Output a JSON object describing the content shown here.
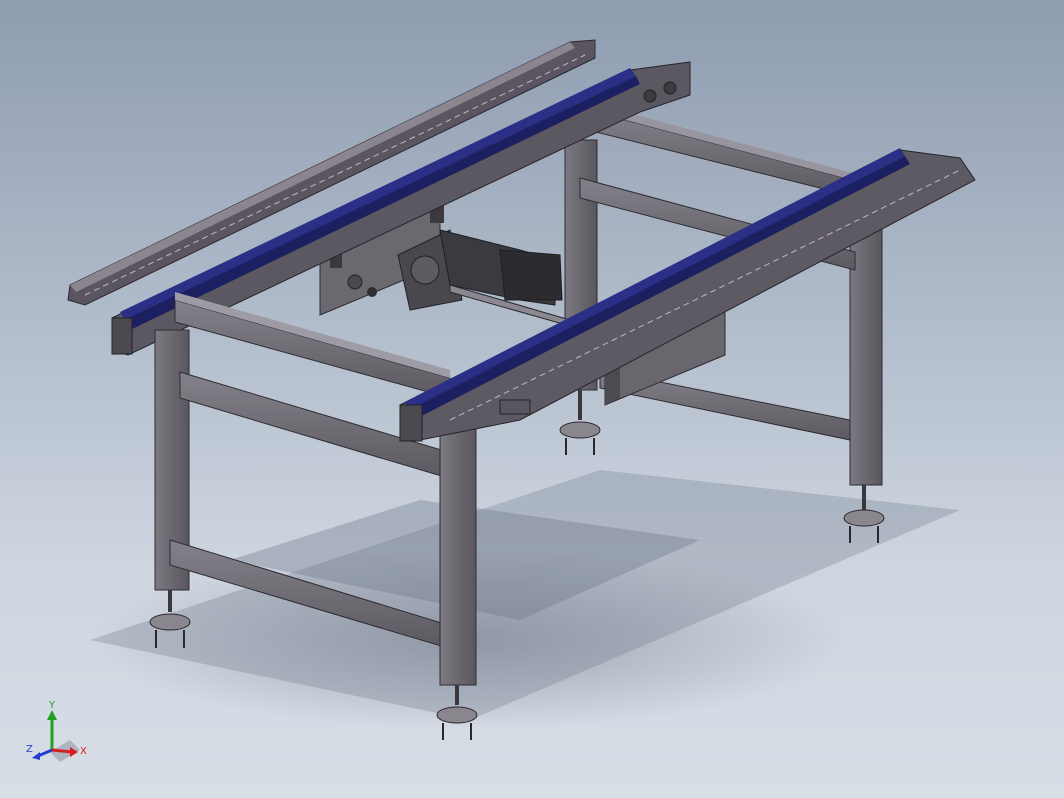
{
  "viewport": {
    "background_top": "#8f9cb0",
    "background_bottom": "#d8dee6"
  },
  "model": {
    "frame_color": "#6e6a70",
    "frame_shade": "#4f4b52",
    "belt_color": "#2b2f86",
    "motor_color": "#3a3a3f"
  },
  "triad": {
    "x_label": "X",
    "y_label": "Y",
    "z_label": "Z",
    "x_color": "#d62020",
    "y_color": "#20a020",
    "z_color": "#2040d0"
  }
}
